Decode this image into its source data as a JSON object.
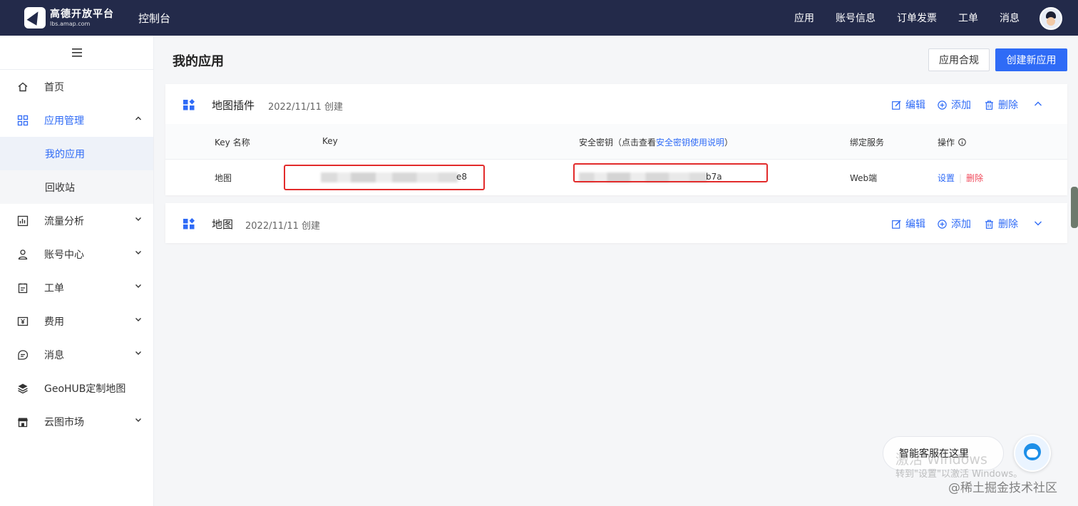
{
  "header": {
    "brand_name": "高德开放平台",
    "brand_sub": "lbs.amap.com",
    "console": "控制台",
    "nav": [
      "应用",
      "账号信息",
      "订单发票",
      "工单",
      "消息"
    ]
  },
  "sidebar": {
    "items": [
      {
        "label": "首页",
        "icon": "home-icon"
      },
      {
        "label": "应用管理",
        "icon": "grid-icon",
        "expanded": true,
        "children": [
          "我的应用",
          "回收站"
        ],
        "active_child": "我的应用"
      },
      {
        "label": "流量分析",
        "icon": "chart-icon"
      },
      {
        "label": "账号中心",
        "icon": "user-icon"
      },
      {
        "label": "工单",
        "icon": "clipboard-icon"
      },
      {
        "label": "费用",
        "icon": "money-icon"
      },
      {
        "label": "消息",
        "icon": "message-icon"
      },
      {
        "label": "GeoHUB定制地图",
        "icon": "layers-icon"
      },
      {
        "label": "云图市场",
        "icon": "store-icon"
      }
    ]
  },
  "main": {
    "title": "我的应用",
    "btn_compliance": "应用合规",
    "btn_create": "创建新应用",
    "actions": {
      "edit": "编辑",
      "add": "添加",
      "delete": "删除"
    },
    "apps": [
      {
        "name": "地图插件",
        "date": "2022/11/11 创建",
        "expanded": true,
        "table": {
          "headers": {
            "key_name": "Key 名称",
            "key": "Key",
            "secret_prefix": "安全密钥（点击查看",
            "secret_link": "安全密钥使用说明",
            "secret_suffix": "）",
            "service": "绑定服务",
            "ops": "操作"
          },
          "row": {
            "key_name": "地图",
            "key_tail": "e8",
            "secret_tail": "b7a",
            "service": "Web端",
            "op_set": "设置",
            "op_del": "删除"
          }
        }
      },
      {
        "name": "地图",
        "date": "2022/11/11 创建",
        "expanded": false
      }
    ]
  },
  "helper": {
    "label": "智能客服在这里"
  },
  "watermarks": {
    "activate_title": "激活 Windows",
    "activate_sub": "转到\"设置\"以激活 Windows。",
    "site": "@稀土掘金技术社区"
  },
  "colors": {
    "accent": "#2f6bf6",
    "topbar": "#232a4a",
    "danger": "#f0495a",
    "highlight_box": "#e22b2b"
  }
}
